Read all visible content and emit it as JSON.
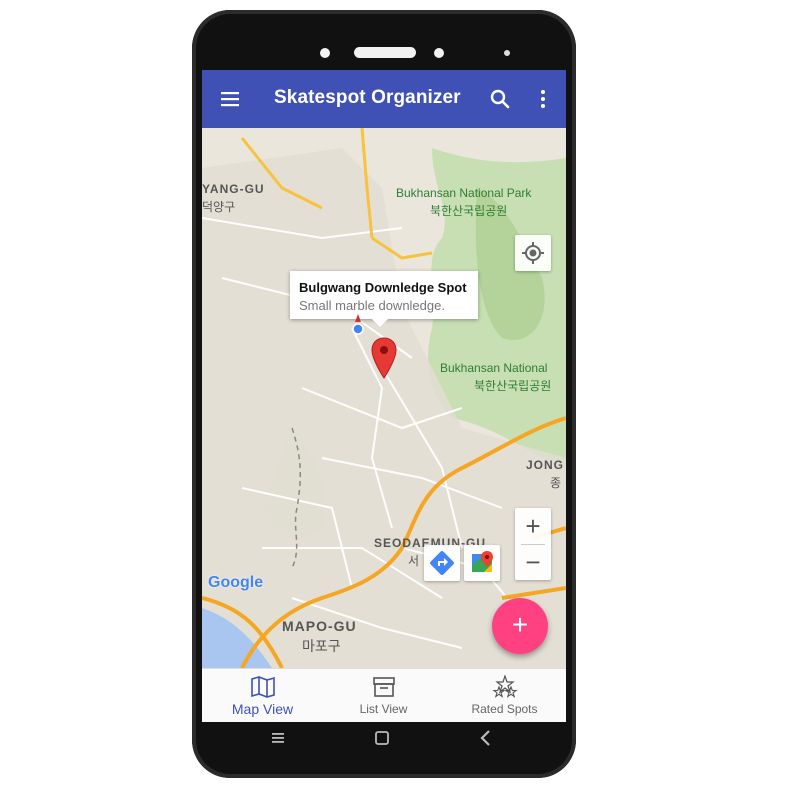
{
  "app": {
    "title": "Skatespot Organizer",
    "accent": "#3f51b5",
    "fab_color": "#ff4081",
    "icons": [
      "menu-icon",
      "search-icon",
      "more-vert-icon"
    ]
  },
  "map": {
    "labels": {
      "yang_gu": "YANG-GU",
      "yang_gu_kor": "덕양구",
      "bukhansan_1": "Bukhansan National Park",
      "bukhansan_1_kor": "북한산국립공원",
      "bukhansan_2": "Bukhansan National",
      "bukhansan_2_kor": "북한산국립공원",
      "jong": "JONG",
      "jong_kor": "종",
      "seodaemun": "SEODAEMUN-GU",
      "seodaemun_kor": "서",
      "mapo": "MAPO-GU",
      "mapo_kor": "마포구",
      "google": "Google"
    },
    "info_window": {
      "title": "Bulgwang Downledge Spot",
      "snippet": "Small marble downledge."
    },
    "zoom_in": "+",
    "zoom_out": "−"
  },
  "fab": {
    "label": "+"
  },
  "bottom_nav": {
    "tabs": [
      {
        "label": "Map View",
        "icon": "map-icon",
        "active": true
      },
      {
        "label": "List View",
        "icon": "archive-icon",
        "active": false
      },
      {
        "label": "Rated Spots",
        "icon": "stars-icon",
        "active": false
      }
    ]
  }
}
